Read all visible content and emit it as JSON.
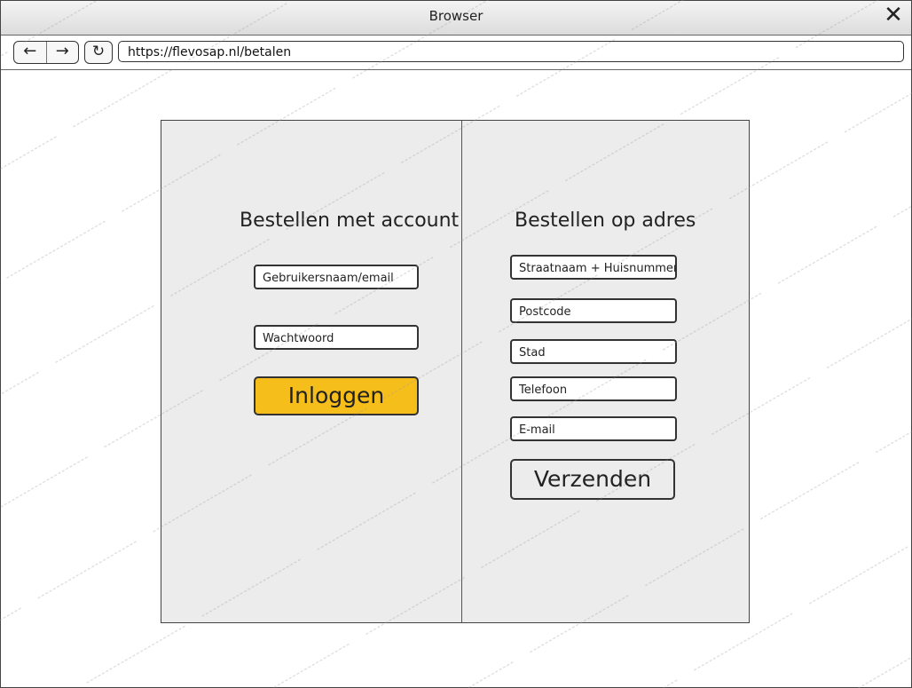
{
  "window": {
    "title": "Browser",
    "close_glyph": "✕"
  },
  "toolbar": {
    "back_glyph": "←",
    "forward_glyph": "→",
    "reload_glyph": "↻",
    "url": "https://flevosap.nl/betalen"
  },
  "account_section": {
    "heading": "Bestellen met account",
    "username_placeholder": "Gebruikersnaam/email",
    "password_placeholder": "Wachtwoord",
    "login_label": "Inloggen"
  },
  "address_section": {
    "heading": "Bestellen op adres",
    "street_placeholder": "Straatnaam + Huisnummer",
    "postcode_placeholder": "Postcode",
    "city_placeholder": "Stad",
    "phone_placeholder": "Telefoon",
    "email_placeholder": "E-mail",
    "send_label": "Verzenden"
  },
  "colors": {
    "login_button": "#f6be1a",
    "panel_background": "#ececec"
  }
}
